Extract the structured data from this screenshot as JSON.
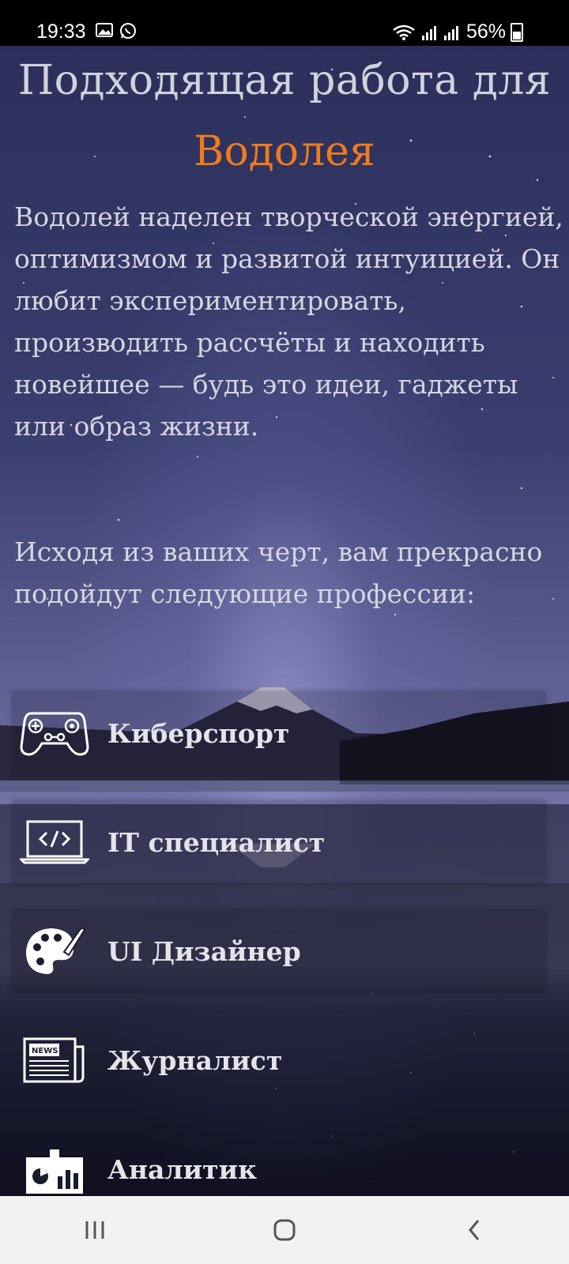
{
  "status_bar": {
    "time": "19:33",
    "battery": "56%"
  },
  "header": {
    "title_line1": "Подходящая работа для",
    "title_line2": "Водолея"
  },
  "description": "Водолей наделен творческой энергией, оптимизмом и развитой интуицией. Он любит экспериментировать, производить рассчёты и находить новейшее — будь это идеи, гаджеты или образ жизни.",
  "intro": "Исходя из ваших черт, вам прекрасно подойдут следующие профессии:",
  "professions": [
    {
      "label": "Киберспорт",
      "icon": "gamepad-icon"
    },
    {
      "label": "IT специалист",
      "icon": "laptop-code-icon"
    },
    {
      "label": "UI Дизайнер",
      "icon": "palette-icon"
    },
    {
      "label": "Журналист",
      "icon": "newspaper-icon"
    },
    {
      "label": "Аналитик",
      "icon": "analytics-icon"
    }
  ],
  "colors": {
    "accent": "#f07b1c",
    "text": "#d6d6e0"
  }
}
